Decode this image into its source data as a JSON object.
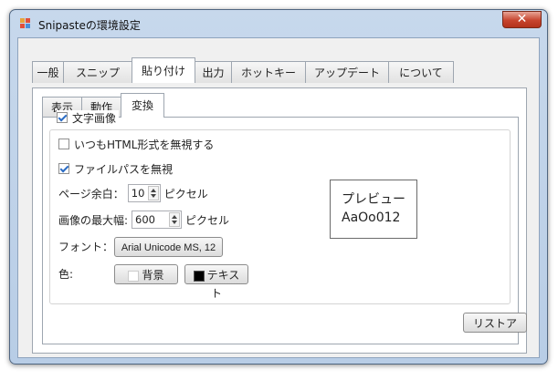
{
  "window": {
    "title": "Snipasteの環境設定",
    "close_glyph": "✕"
  },
  "tabs": [
    {
      "label": "一般"
    },
    {
      "label": "スニップ"
    },
    {
      "label": "貼り付け",
      "active": true
    },
    {
      "label": "出力"
    },
    {
      "label": "ホットキー"
    },
    {
      "label": "アップデート"
    },
    {
      "label": "について"
    }
  ],
  "subtabs": [
    {
      "label": "表示"
    },
    {
      "label": "動作"
    },
    {
      "label": "変換",
      "active": true
    }
  ],
  "text_image": {
    "label": "文字画像",
    "checked": true,
    "ignore_html": {
      "label": "いつもHTML形式を無視する",
      "checked": false
    },
    "ignore_filepath": {
      "label": "ファイルパスを無視",
      "checked": true
    },
    "page_margin": {
      "label": "ページ余白：",
      "value": "10",
      "unit": "ピクセル"
    },
    "max_width": {
      "label": "画像の最大幅:",
      "value": "600",
      "unit": "ピクセル"
    },
    "font": {
      "label": "フォント：",
      "value": "Arial Unicode MS, 12"
    },
    "color": {
      "label": "色:",
      "background_label": "背景",
      "text_label": "テキスト",
      "background_color": "#ffffff",
      "text_color": "#000000"
    }
  },
  "preview": {
    "line1": "プレビュー",
    "line2": "AaOo012"
  },
  "restore_label": "リストア",
  "colors": {
    "title_bar": "#b8cde6",
    "check_accent": "#2b6cc4",
    "close_red": "#c7442e"
  },
  "icons": {
    "app": "snipaste-app-icon",
    "close": "close-icon"
  }
}
